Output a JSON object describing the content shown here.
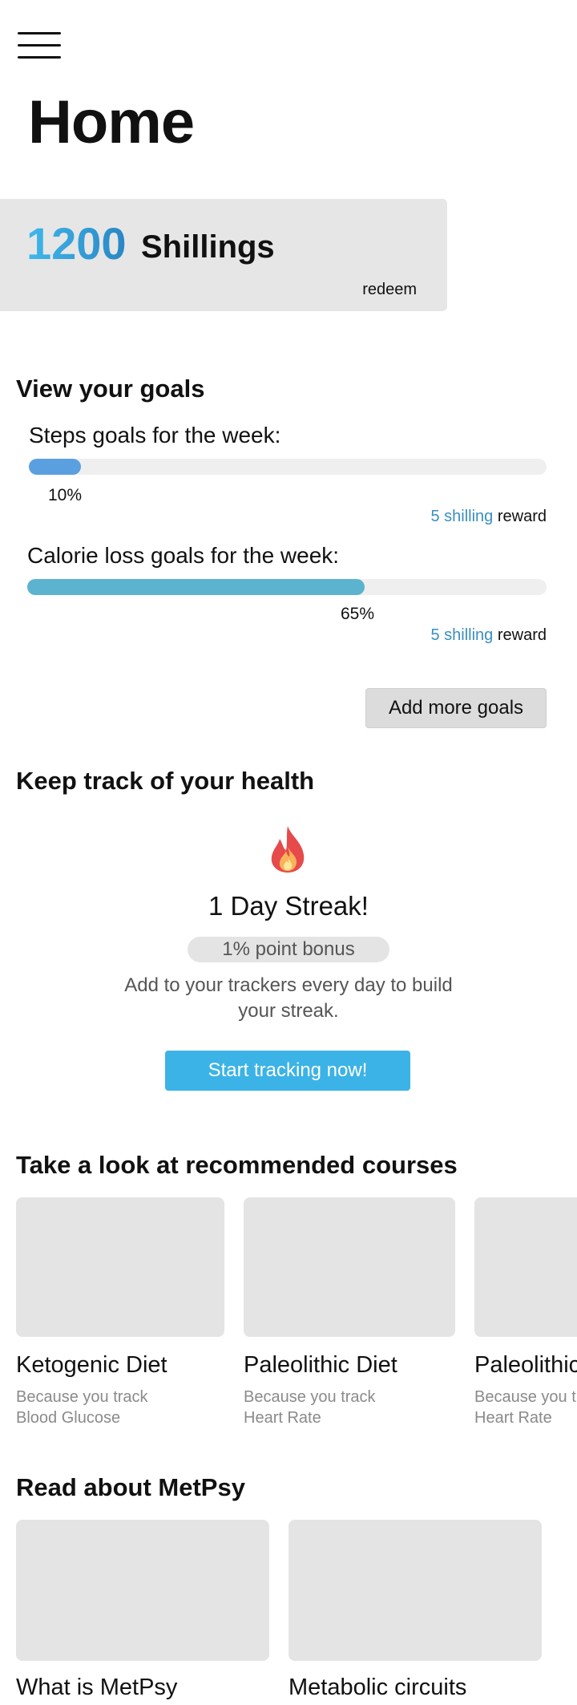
{
  "header": {
    "menu_icon": "hamburger-menu-icon",
    "title": "Home"
  },
  "balance": {
    "amount": "1200",
    "unit": "Shillings",
    "redeem_label": "redeem",
    "accent": "#3fb8ec"
  },
  "goals": {
    "heading": "View your goals",
    "items": [
      {
        "label": "Steps goals for the week:",
        "progress_percent": 10,
        "percent_label": "10%",
        "reward_amount": "5 shilling",
        "reward_suffix": "reward",
        "bar_color": "#5aa0e0"
      },
      {
        "label": "Calorie loss goals for the week:",
        "progress_percent": 65,
        "percent_label": "65%",
        "reward_amount": "5 shilling",
        "reward_suffix": "reward",
        "bar_color": "#5bb3cf"
      }
    ],
    "add_button": "Add more goals"
  },
  "health": {
    "heading": "Keep track of your health",
    "icon": "flame-icon",
    "streak": "1 Day Streak!",
    "bonus": "1% point bonus",
    "description": "Add to your trackers every day to build your streak.",
    "cta": "Start tracking now!"
  },
  "courses": {
    "heading": "Take a look at recommended courses",
    "items": [
      {
        "title": "Ketogenic Diet",
        "reason": "Because you track",
        "metric": "Blood Glucose"
      },
      {
        "title": "Paleolithic Diet",
        "reason": "Because you track",
        "metric": "Heart Rate"
      },
      {
        "title": "Paleolithic Diet",
        "reason": "Because you track",
        "metric": "Heart Rate"
      }
    ]
  },
  "articles": {
    "heading": "Read about MetPsy",
    "items": [
      {
        "title": "What is MetPsy"
      },
      {
        "title": "Metabolic circuits"
      }
    ]
  }
}
